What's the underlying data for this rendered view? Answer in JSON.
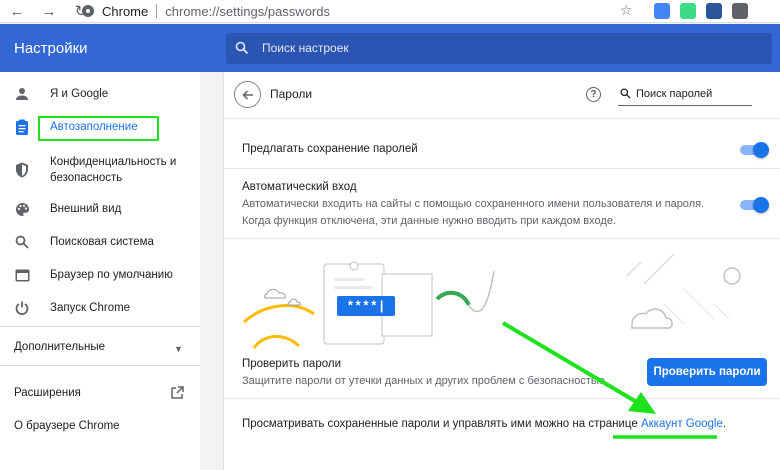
{
  "browser": {
    "omnibox_chip": "Chrome",
    "url": "chrome://settings/passwords"
  },
  "header": {
    "title": "Настройки",
    "search_placeholder": "Поиск настроек"
  },
  "sidebar": {
    "items": [
      {
        "label": "Я и Google",
        "icon": "person-icon"
      },
      {
        "label": "Автозаполнение",
        "icon": "clipboard-icon"
      },
      {
        "label": "Конфиденциальность и безопасность",
        "icon": "shield-icon"
      },
      {
        "label": "Внешний вид",
        "icon": "palette-icon"
      },
      {
        "label": "Поисковая система",
        "icon": "search-icon"
      },
      {
        "label": "Браузер по умолчанию",
        "icon": "browser-icon"
      },
      {
        "label": "Запуск Chrome",
        "icon": "power-icon"
      }
    ],
    "advanced": "Дополнительные",
    "extensions": "Расширения",
    "about": "О браузере Chrome"
  },
  "passwords": {
    "title": "Пароли",
    "search_placeholder": "Поиск паролей",
    "offer_save": "Предлагать сохранение паролей",
    "offer_save_on": true,
    "auto_signin": "Автоматический вход",
    "auto_signin_desc_1": "Автоматически входить на сайты с помощью сохраненного имени пользователя и пароля.",
    "auto_signin_desc_2": "Когда функция отключена, эти данные нужно вводить при каждом входе.",
    "auto_signin_on": true,
    "illustration_password": "****|",
    "check_title": "Проверить пароли",
    "check_desc": "Защитите пароли от утечки данных и других проблем с безопасностью.",
    "check_button": "Проверить пароли",
    "manage_text": "Просматривать сохраненные пароли и управлять ими можно на странице",
    "manage_link": "Аккаунт Google",
    "manage_end": "."
  },
  "colors": {
    "header_bg": "#3367d6",
    "accent": "#1a73e8",
    "annotation": "#1de21d"
  }
}
